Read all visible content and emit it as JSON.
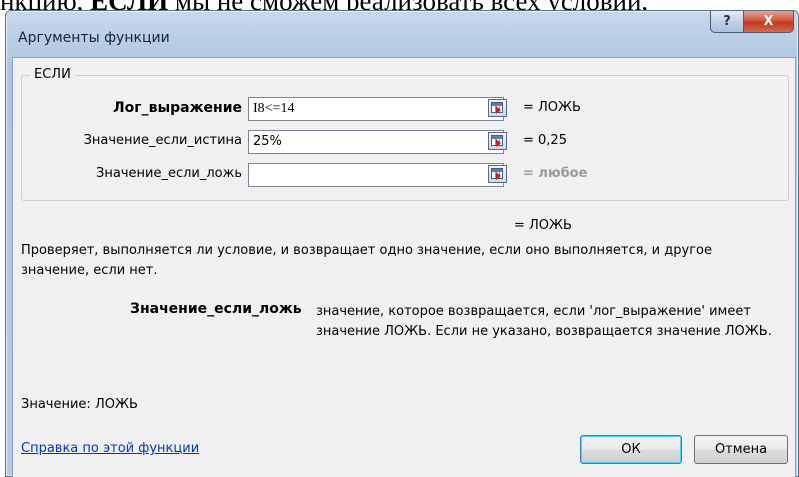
{
  "doc_text": {
    "before": "нкцию, ",
    "bold": "ЕСЛИ",
    "after": " мы не сможем реализовать всех условий,"
  },
  "window": {
    "title": "Аргументы функции",
    "help_label": "?",
    "close_label": "X"
  },
  "function": {
    "name": "ЕСЛИ",
    "args": [
      {
        "label": "Лог_выражение",
        "value": "I8<=14",
        "result": "= ЛОЖЬ"
      },
      {
        "label": "Значение_если_истина",
        "value": "25%",
        "result": "= 0,25"
      },
      {
        "label": "Значение_если_ложь",
        "value": "",
        "result": "= любое"
      }
    ],
    "overall_result": "= ЛОЖЬ",
    "description": "Проверяет, выполняется ли условие, и возвращает одно значение, если оно выполняется, и другое значение, если нет.",
    "param_name": "Значение_если_ложь",
    "param_description": "значение, которое возвращается, если 'лог_выражение' имеет значение ЛОЖЬ. Если не указано, возвращается значение ЛОЖЬ."
  },
  "footer": {
    "value_line": "Значение:  ЛОЖЬ",
    "help_link": "Справка по этой функции",
    "ok_label": "ОК",
    "cancel_label": "Отмена"
  }
}
